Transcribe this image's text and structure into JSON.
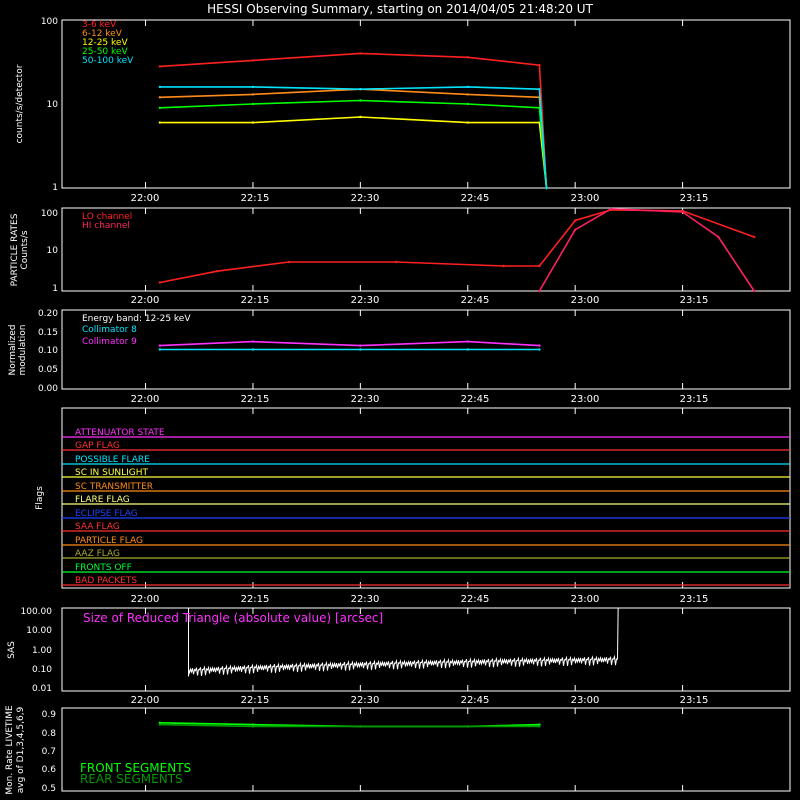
{
  "title": "HESSI Observing Summary, starting on 2014/04/05 21:48:20 UT",
  "time_ticks": [
    "22:00",
    "22:15",
    "22:30",
    "22:45",
    "23:00",
    "23:15"
  ],
  "panels": {
    "rates": {
      "ylabel": "counts/s/detector",
      "tick_labels": [
        "100",
        "10",
        "1"
      ],
      "legend": [
        {
          "label": "3-6 keV",
          "color": "#ff2020"
        },
        {
          "label": "6-12 keV",
          "color": "#ff8c1a"
        },
        {
          "label": "12-25 keV",
          "color": "#ffff00"
        },
        {
          "label": "25-50 keV",
          "color": "#00ff00"
        },
        {
          "label": "50-100 keV",
          "color": "#00e5ff"
        }
      ]
    },
    "particle": {
      "ylabel_1": "PARTICLE RATES",
      "ylabel_2": "Counts/s",
      "tick_labels": [
        "100",
        "10",
        "1"
      ],
      "legend": [
        {
          "label": "LO channel",
          "color": "#ff2020"
        },
        {
          "label": "HI channel",
          "color": "#ff2060"
        }
      ]
    },
    "modulation": {
      "ylabel_1": "Normalized",
      "ylabel_2": "modulation",
      "tick_labels": [
        "0.20",
        "0.15",
        "0.10",
        "0.05",
        "0.00"
      ],
      "legend": [
        {
          "label": "Energy band: 12-25 keV",
          "color": "#ffffff"
        },
        {
          "label": "Collimator 8",
          "color": "#00e5ff"
        },
        {
          "label": "Collimator 9",
          "color": "#ff30ff"
        }
      ]
    },
    "flags": {
      "ylabel": "Flags",
      "items": [
        {
          "label": "ATTENUATOR STATE",
          "color": "#ff30ff"
        },
        {
          "label": "GAP FLAG",
          "color": "#ff3030"
        },
        {
          "label": "POSSIBLE FLARE",
          "color": "#00e5ff"
        },
        {
          "label": "SC IN SUNLIGHT",
          "color": "#ffff40"
        },
        {
          "label": "SC TRANSMITTER",
          "color": "#ff8c1a"
        },
        {
          "label": "FLARE FLAG",
          "color": "#ffff80"
        },
        {
          "label": "ECLIPSE FLAG",
          "color": "#2040ff"
        },
        {
          "label": "SAA FLAG",
          "color": "#ff3030"
        },
        {
          "label": "PARTICLE FLAG",
          "color": "#ff8c1a"
        },
        {
          "label": "AAZ FLAG",
          "color": "#aaaa30"
        },
        {
          "label": "FRONTS OFF",
          "color": "#00ff30"
        },
        {
          "label": "BAD PACKETS",
          "color": "#ff3030"
        }
      ]
    },
    "sas": {
      "ylabel": "SAS",
      "tick_labels": [
        "100.00",
        "10.00",
        "1.00",
        "0.10",
        "0.01"
      ],
      "annotation": "Size of Reduced Triangle (absolute value) [arcsec]",
      "annotation_color": "#ff30ff"
    },
    "livetime": {
      "ylabel_1": "Mon. Rate LIVETIME",
      "ylabel_2": "avg of D1,3,4,5,6,9",
      "tick_labels": [
        "0.9",
        "0.8",
        "0.7",
        "0.6",
        "0.5"
      ],
      "legend": [
        {
          "label": "FRONT SEGMENTS",
          "color": "#00ff00"
        },
        {
          "label": "REAR SEGMENTS",
          "color": "#009900"
        }
      ]
    }
  },
  "chart_data": {
    "type": "line",
    "x_axis": "time UT",
    "xlim": [
      "21:48:20",
      "23:30:00"
    ],
    "series": [
      {
        "name": "3-6 keV",
        "panel": "rates",
        "scale": "log",
        "x": [
          "22:02",
          "22:15",
          "22:30",
          "22:45",
          "22:55",
          "22:56"
        ],
        "values": [
          28,
          33,
          40,
          36,
          29,
          1
        ]
      },
      {
        "name": "6-12 keV",
        "panel": "rates",
        "scale": "log",
        "x": [
          "22:02",
          "22:15",
          "22:30",
          "22:45",
          "22:55",
          "22:56"
        ],
        "values": [
          12,
          13,
          15,
          13,
          12,
          1
        ]
      },
      {
        "name": "12-25 keV",
        "panel": "rates",
        "scale": "log",
        "x": [
          "22:02",
          "22:15",
          "22:30",
          "22:45",
          "22:55",
          "22:56"
        ],
        "values": [
          6,
          6,
          7,
          6,
          6,
          1
        ]
      },
      {
        "name": "25-50 keV",
        "panel": "rates",
        "scale": "log",
        "x": [
          "22:02",
          "22:15",
          "22:30",
          "22:45",
          "22:55",
          "22:56"
        ],
        "values": [
          9,
          10,
          11,
          10,
          9,
          1
        ]
      },
      {
        "name": "50-100 keV",
        "panel": "rates",
        "scale": "log",
        "x": [
          "22:02",
          "22:15",
          "22:30",
          "22:45",
          "22:55",
          "22:56"
        ],
        "values": [
          16,
          16,
          15,
          16,
          15,
          1
        ]
      },
      {
        "name": "LO channel",
        "panel": "particle",
        "scale": "log",
        "x": [
          "22:02",
          "22:10",
          "22:20",
          "22:35",
          "22:50",
          "22:55",
          "23:00",
          "23:05",
          "23:15",
          "23:25"
        ],
        "values": [
          1.6,
          3,
          5,
          5,
          4,
          4,
          50,
          90,
          85,
          20
        ]
      },
      {
        "name": "HI channel",
        "panel": "particle",
        "scale": "log",
        "x": [
          "22:55",
          "23:00",
          "23:05",
          "23:15",
          "23:20",
          "23:25"
        ],
        "values": [
          1,
          30,
          95,
          80,
          20,
          1
        ]
      },
      {
        "name": "Collimator 8",
        "panel": "modulation",
        "x": [
          "22:02",
          "22:15",
          "22:30",
          "22:45",
          "22:55"
        ],
        "values": [
          0.1,
          0.1,
          0.1,
          0.1,
          0.1
        ]
      },
      {
        "name": "Collimator 9",
        "panel": "modulation",
        "x": [
          "22:02",
          "22:15",
          "22:30",
          "22:45",
          "22:55"
        ],
        "values": [
          0.11,
          0.12,
          0.11,
          0.12,
          0.11
        ]
      },
      {
        "name": "FRONT SEGMENTS",
        "panel": "livetime",
        "x": [
          "22:02",
          "22:15",
          "22:30",
          "22:45",
          "22:55"
        ],
        "values": [
          0.87,
          0.86,
          0.85,
          0.85,
          0.86
        ]
      },
      {
        "name": "REAR SEGMENTS",
        "panel": "livetime",
        "x": [
          "22:02",
          "22:15",
          "22:30",
          "22:45",
          "22:55"
        ],
        "values": [
          0.86,
          0.85,
          0.85,
          0.85,
          0.85
        ]
      }
    ],
    "panel_ylims": {
      "rates": [
        1,
        100
      ],
      "particle": [
        1,
        100
      ],
      "modulation": [
        0,
        0.2
      ],
      "sas": [
        0.01,
        100
      ],
      "livetime": [
        0.5,
        0.95
      ]
    }
  }
}
